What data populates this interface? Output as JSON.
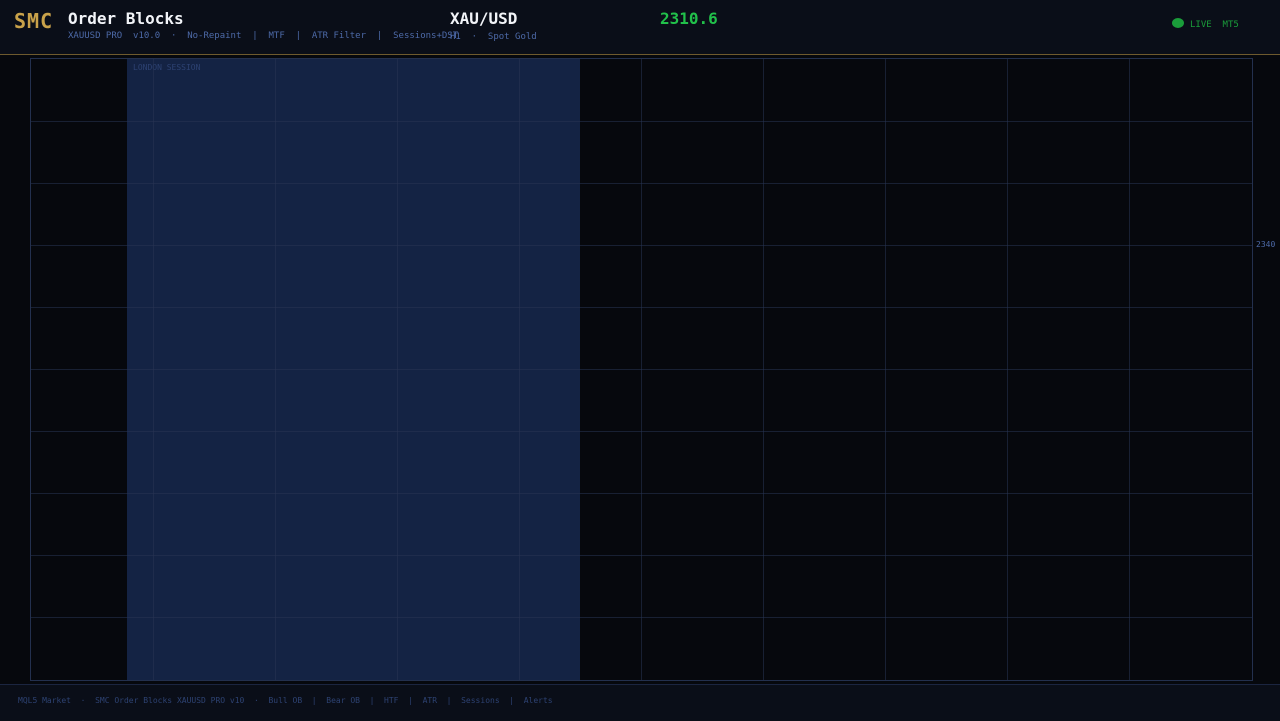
{
  "colors": {
    "brand": "#c9a24a",
    "accent": "#4d6aa8",
    "price": "#21c04a",
    "live": "#1a9d3a"
  },
  "header": {
    "brand": "SMC",
    "title": "Order Blocks",
    "subtitle": "XAUUSD PRO  v10.0  ·  No-Repaint  |  MTF  |  ATR Filter  |  Sessions+DST",
    "symbol": "XAU/USD",
    "symbol_sub": "H1  ·  Spot Gold",
    "price": "2310.6",
    "status_live": "LIVE",
    "platform": "MT5",
    "status_icon": "live-dot-icon"
  },
  "chart": {
    "session_label": "LONDON SESSION",
    "price_ticks": [
      "2340"
    ]
  },
  "footer": {
    "text": "MQL5 Market  ·  SMC Order Blocks XAUUSD PRO v10  ·  Bull OB  |  Bear OB  |  HTF  |  ATR  |  Sessions  |  Alerts"
  }
}
